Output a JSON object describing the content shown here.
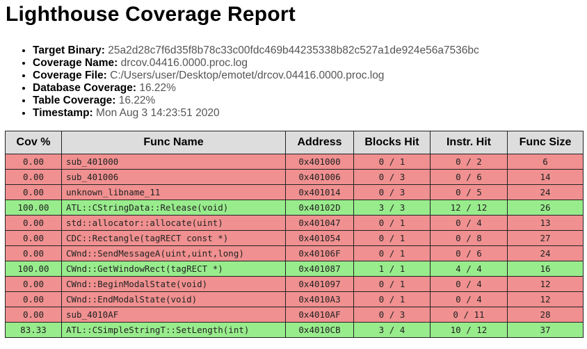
{
  "title": "Lighthouse Coverage Report",
  "info": [
    {
      "label": "Target Binary:",
      "value": "25a2d28c7f6d35f8b78c33c00fdc469b44235338b82c527a1de924e56a7536bc"
    },
    {
      "label": "Coverage Name:",
      "value": "drcov.04416.0000.proc.log"
    },
    {
      "label": "Coverage File:",
      "value": "C:/Users/user/Desktop/emotet/drcov.04416.0000.proc.log"
    },
    {
      "label": "Database Coverage:",
      "value": "16.22%"
    },
    {
      "label": "Table Coverage:",
      "value": "16.22%"
    },
    {
      "label": "Timestamp:",
      "value": "Mon Aug 3 14:23:51 2020"
    }
  ],
  "table": {
    "headers": [
      "Cov %",
      "Func Name",
      "Address",
      "Blocks Hit",
      "Instr. Hit",
      "Func Size"
    ],
    "rows": [
      {
        "status": "red",
        "cov": "0.00",
        "name": "sub_401000",
        "addr": "0x401000",
        "blocks": "0 / 1",
        "instr": "0 / 2",
        "size": "6"
      },
      {
        "status": "red",
        "cov": "0.00",
        "name": "sub_401006",
        "addr": "0x401006",
        "blocks": "0 / 3",
        "instr": "0 / 6",
        "size": "14"
      },
      {
        "status": "red",
        "cov": "0.00",
        "name": "unknown_libname_11",
        "addr": "0x401014",
        "blocks": "0 / 3",
        "instr": "0 / 5",
        "size": "24"
      },
      {
        "status": "green",
        "cov": "100.00",
        "name": "ATL::CStringData::Release(void)",
        "addr": "0x40102D",
        "blocks": "3 / 3",
        "instr": "12 / 12",
        "size": "26"
      },
      {
        "status": "red",
        "cov": "0.00",
        "name": "std::allocator::allocate(uint)",
        "addr": "0x401047",
        "blocks": "0 / 1",
        "instr": "0 / 4",
        "size": "13"
      },
      {
        "status": "red",
        "cov": "0.00",
        "name": "CDC::Rectangle(tagRECT const *)",
        "addr": "0x401054",
        "blocks": "0 / 1",
        "instr": "0 / 8",
        "size": "27"
      },
      {
        "status": "red",
        "cov": "0.00",
        "name": "CWnd::SendMessageA(uint,uint,long)",
        "addr": "0x40106F",
        "blocks": "0 / 1",
        "instr": "0 / 6",
        "size": "24"
      },
      {
        "status": "green",
        "cov": "100.00",
        "name": "CWnd::GetWindowRect(tagRECT *)",
        "addr": "0x401087",
        "blocks": "1 / 1",
        "instr": "4 / 4",
        "size": "16"
      },
      {
        "status": "red",
        "cov": "0.00",
        "name": "CWnd::BeginModalState(void)",
        "addr": "0x401097",
        "blocks": "0 / 1",
        "instr": "0 / 4",
        "size": "12"
      },
      {
        "status": "red",
        "cov": "0.00",
        "name": "CWnd::EndModalState(void)",
        "addr": "0x4010A3",
        "blocks": "0 / 1",
        "instr": "0 / 4",
        "size": "12"
      },
      {
        "status": "red",
        "cov": "0.00",
        "name": "sub_4010AF",
        "addr": "0x4010AF",
        "blocks": "0 / 3",
        "instr": "0 / 11",
        "size": "28"
      },
      {
        "status": "green",
        "cov": "83.33",
        "name": "ATL::CSimpleStringT::SetLength(int)",
        "addr": "0x4010CB",
        "blocks": "3 / 4",
        "instr": "10 / 12",
        "size": "37"
      }
    ]
  },
  "colors": {
    "covered": "#98ec8c",
    "uncovered": "#f09090",
    "header": "#dddddd"
  }
}
